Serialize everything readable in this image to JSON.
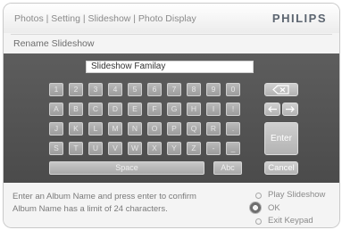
{
  "header": {
    "breadcrumb": "Photos | Setting | Slideshow | Photo Display",
    "brand": "PHILIPS"
  },
  "subtitle": "Rename Slideshow",
  "input": {
    "value": "Slideshow Familay"
  },
  "keyboard": {
    "row1": [
      "1",
      "2",
      "3",
      "4",
      "5",
      "6",
      "7",
      "8",
      "9",
      "0"
    ],
    "row2": [
      "A",
      "B",
      "C",
      "D",
      "E",
      "F",
      "G",
      "H",
      "I",
      "!"
    ],
    "row3": [
      "J",
      "K",
      "L",
      "M",
      "N",
      "O",
      "P",
      "Q",
      "R",
      "."
    ],
    "row4": [
      "S",
      "T",
      "U",
      "V",
      "W",
      "X",
      "Y",
      "Z",
      "-",
      "_"
    ],
    "space": "Space",
    "abc": "Abc",
    "enter": "Enter",
    "cancel": "Cancel",
    "backspace_icon": "backspace-icon",
    "left_arrow_icon": "left-arrow-icon",
    "right_arrow_icon": "right-arrow-icon"
  },
  "footer": {
    "help_line1": "Enter an Album Name and press enter to confirm",
    "help_line2": "Album Name has a limit of 24 characters.",
    "options": [
      "Play Slideshow",
      "OK",
      "Exit Keypad"
    ]
  }
}
